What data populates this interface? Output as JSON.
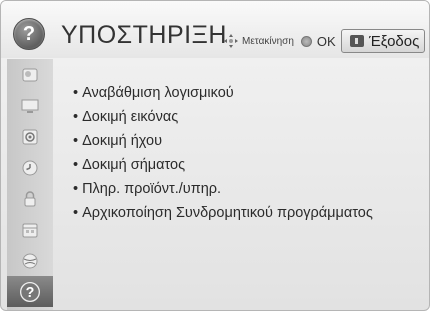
{
  "header": {
    "title": "ΥΠΟΣΤΗΡΙΞΗ",
    "move_hint": "Μετακίνηση",
    "ok_hint": "OK",
    "exit_label": "Έξοδος"
  },
  "sidebar": {
    "icons": [
      "picture-icon",
      "monitor-icon",
      "speaker-icon",
      "clock-icon",
      "lock-icon",
      "calendar-icon",
      "globe-icon",
      "help-icon"
    ],
    "active_index": 7
  },
  "menu": {
    "items": [
      "Αναβάθμιση λογισμικού",
      "Δοκιμή εικόνας",
      "Δοκιμή ήχου",
      "Δοκιμή σήματος",
      "Πληρ. προϊόντ./υπηρ.",
      "Αρχικοποίηση Συνδρομητικού προγράμματος"
    ]
  },
  "colors": {
    "accent_active": "#6b6b6b",
    "text": "#2b2b2b"
  }
}
